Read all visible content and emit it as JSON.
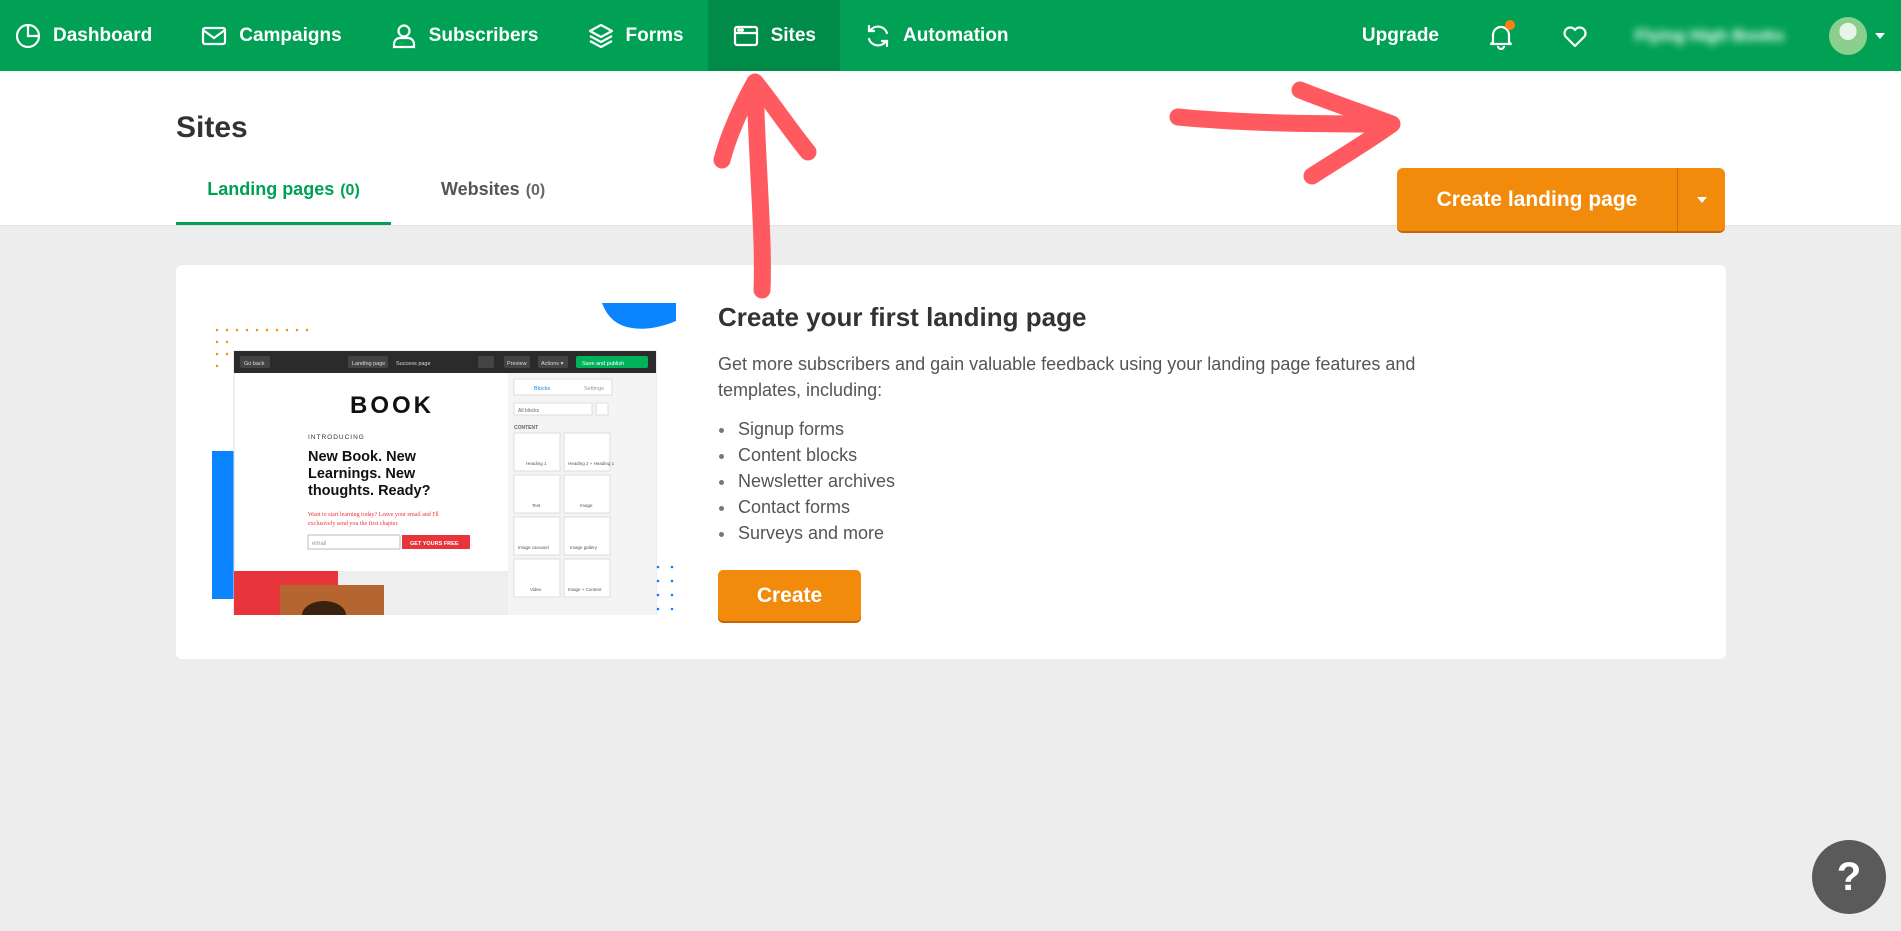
{
  "nav": {
    "items": [
      {
        "label": "Dashboard",
        "icon": "dashboard-icon"
      },
      {
        "label": "Campaigns",
        "icon": "envelope-icon"
      },
      {
        "label": "Subscribers",
        "icon": "user-icon"
      },
      {
        "label": "Forms",
        "icon": "layers-icon"
      },
      {
        "label": "Sites",
        "icon": "browser-window-icon",
        "active": true
      },
      {
        "label": "Automation",
        "icon": "refresh-icon"
      }
    ],
    "upgrade_label": "Upgrade",
    "account_name": "Flying High Books",
    "colors": {
      "bar": "#00a154",
      "active": "#008c48",
      "notification": "#ff7f14"
    }
  },
  "header": {
    "title": "Sites",
    "tabs": [
      {
        "label": "Landing pages",
        "count": "(0)",
        "active": true
      },
      {
        "label": "Websites",
        "count": "(0)",
        "active": false
      }
    ],
    "create_button_label": "Create landing page"
  },
  "card": {
    "title": "Create your first landing page",
    "description": "Get more subscribers and gain valuable feedback using your landing page features and templates, including:",
    "features": [
      "Signup forms",
      "Content blocks",
      "Newsletter archives",
      "Contact forms",
      "Surveys and more"
    ],
    "create_label": "Create"
  },
  "illustration": {
    "toolbar_back": "Go back",
    "toolbar_tabs": [
      "Landing page",
      "Success page"
    ],
    "toolbar_preview": "Preview",
    "toolbar_actions": "Actions ▾",
    "toolbar_publish": "Save and publish",
    "book_logo": "BOOK",
    "introducing": "INTRODUCING",
    "headline": [
      "New Book. New",
      "Learnings. New",
      "thoughts. Ready?"
    ],
    "subtext": [
      "Want to start learning today? Leave your email and I'll",
      "exclusively send you the first chapter."
    ],
    "email_placeholder": "email",
    "cta": "GET YOURS FREE",
    "panel_tabs": [
      "Blocks",
      "Settings"
    ],
    "panel_select": "All blocks",
    "panel_section": "CONTENT",
    "blocks": [
      "Heading 1",
      "Heading 2 + Heading 1",
      "Text",
      "Image",
      "Image carousel",
      "Image gallery",
      "Video",
      "Image + Content"
    ]
  },
  "help_label": "?",
  "accent_color": "#f28a0c"
}
